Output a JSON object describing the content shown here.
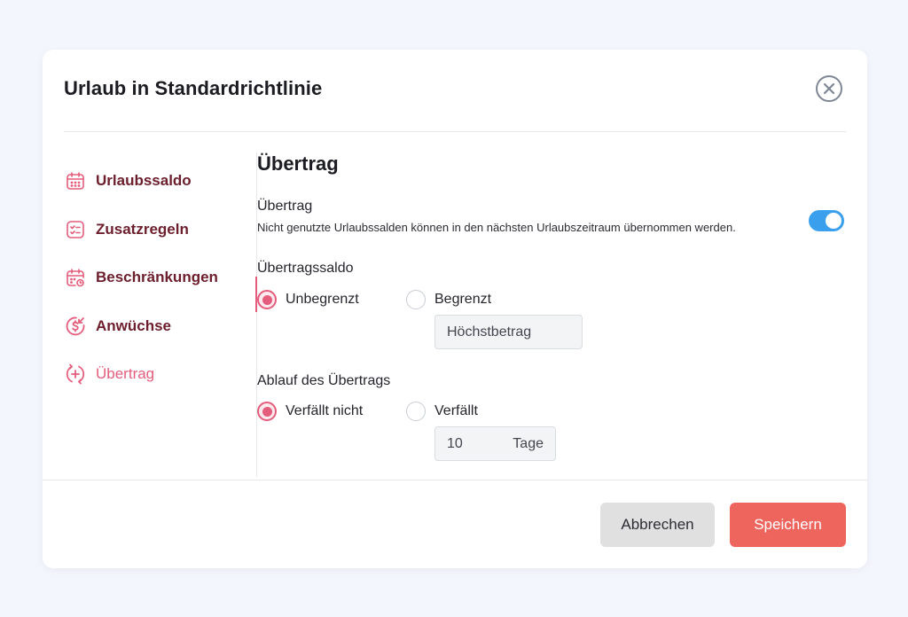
{
  "dialog": {
    "title": "Urlaub in Standardrichtlinie"
  },
  "sidebar": {
    "items": [
      {
        "label": "Urlaubssaldo",
        "icon": "calendar-icon"
      },
      {
        "label": "Zusatzregeln",
        "icon": "checklist-icon"
      },
      {
        "label": "Beschränkungen",
        "icon": "calendar-clock-icon"
      },
      {
        "label": "Anwüchse",
        "icon": "dollar-accrual-icon"
      },
      {
        "label": "Übertrag",
        "icon": "carryover-plus-icon",
        "active": true
      }
    ]
  },
  "content": {
    "section_title": "Übertrag",
    "carryover_label": "Übertrag",
    "carryover_description": "Nicht genutzte Urlaubssalden können in den nächsten Urlaubszeitraum übernommen werden.",
    "carryover_enabled": true,
    "balance": {
      "label": "Übertragssaldo",
      "options": [
        "Unbegrenzt",
        "Begrenzt"
      ],
      "selected": "Unbegrenzt",
      "max_placeholder": "Höchstbetrag"
    },
    "expiry": {
      "label": "Ablauf des Übertrags",
      "options": [
        "Verfällt nicht",
        "Verfällt"
      ],
      "selected": "Verfällt nicht",
      "days_value": "10",
      "days_unit": "Tage"
    }
  },
  "footer": {
    "cancel_label": "Abbrechen",
    "save_label": "Speichern"
  },
  "colors": {
    "accent": "#e45d7c",
    "nav_text": "#6c1e2c",
    "toggle_on": "#3aa0ee",
    "save_button": "#ed655d"
  }
}
